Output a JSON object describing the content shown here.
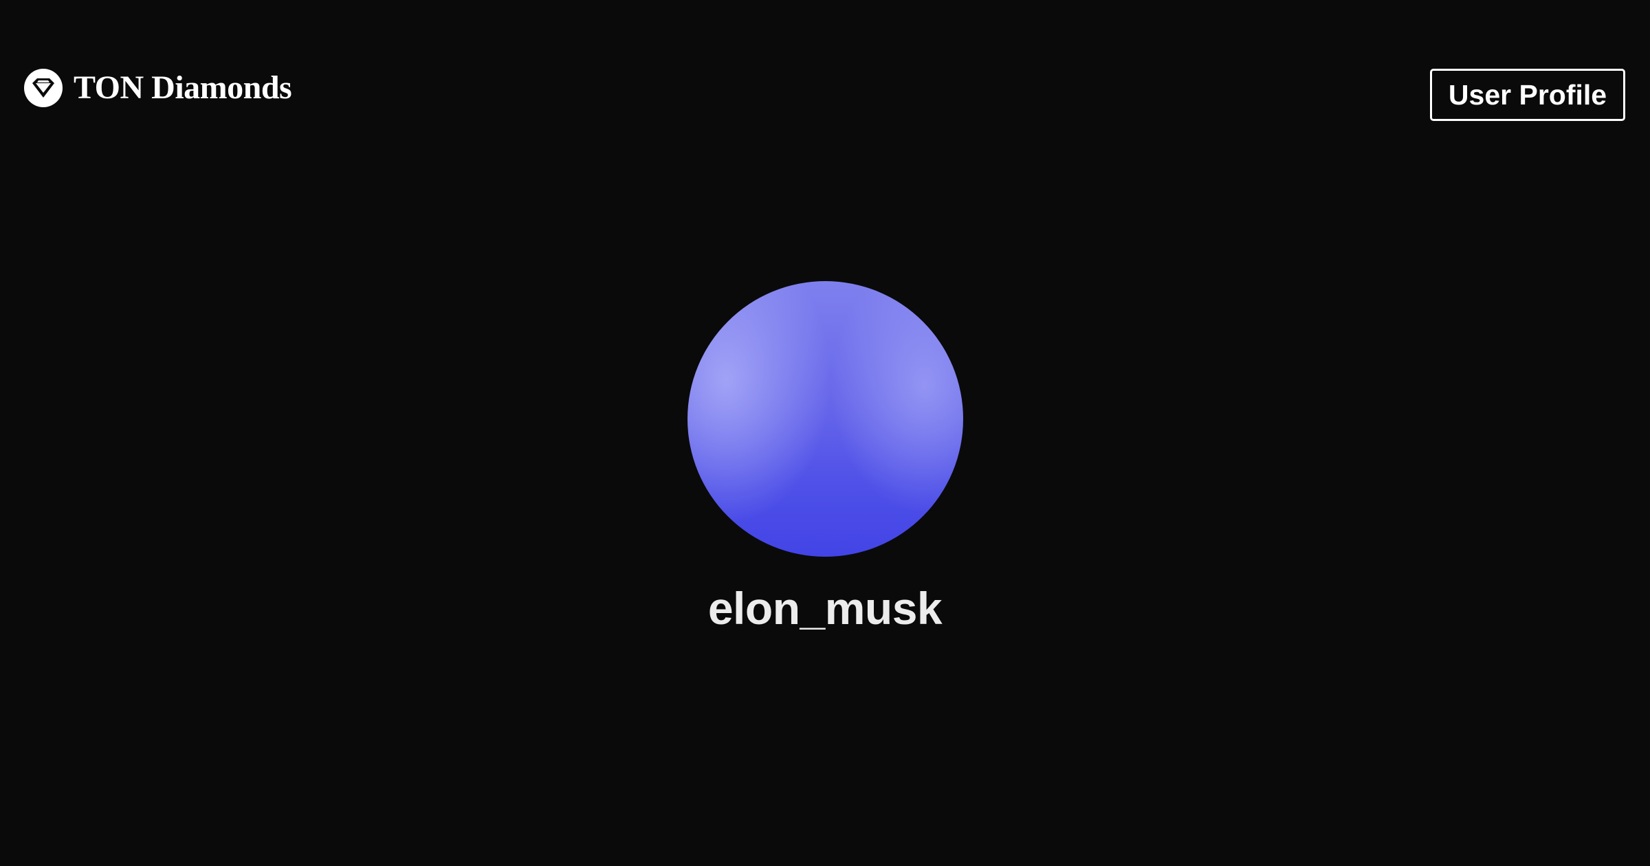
{
  "header": {
    "brand_icon": "diamond-icon",
    "brand_name": "TON Diamonds",
    "profile_button_label": "User Profile"
  },
  "profile": {
    "username": "elon_musk"
  },
  "colors": {
    "background": "#0a0a0b",
    "text": "#ffffff",
    "avatar_primary": "#5b5ce8",
    "avatar_highlight": "#9b9cf5"
  }
}
